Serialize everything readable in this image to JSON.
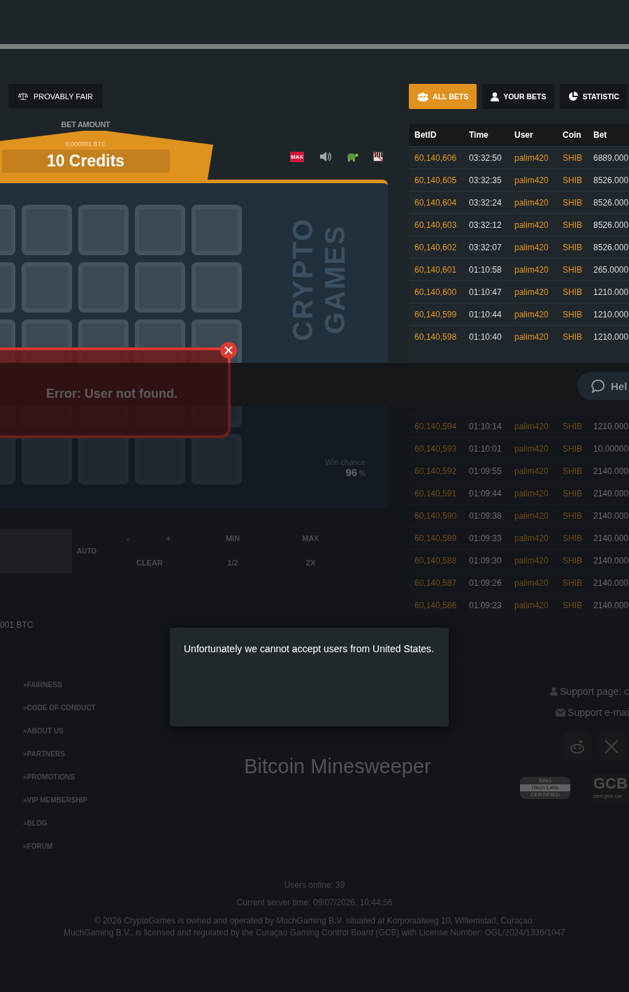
{
  "game_bar": {
    "provably_fair": "PROVABLY FAIR"
  },
  "bet_amount": {
    "label": "BET AMOUNT",
    "btc": "0.000001 BTC",
    "credits": "10 Credits",
    "max_badge": "MAX"
  },
  "board": {
    "logo": "CRYPTO GAMES",
    "win_chance_label": "Win chance",
    "win_chance": "96",
    "win_chance_unit": "%"
  },
  "controls": {
    "auto": "AUTO",
    "buttons": [
      {
        "kind": "minus",
        "label": "-"
      },
      {
        "kind": "plus",
        "label": "+"
      },
      {
        "kind": "wide",
        "label": "MIN"
      },
      {
        "kind": "wide",
        "label": "MAX"
      },
      {
        "kind": "wide",
        "label": "CLEAR"
      },
      {
        "kind": "wide",
        "label": "1/2"
      },
      {
        "kind": "wide",
        "label": "2X"
      }
    ]
  },
  "balance_text": "001 BTC",
  "error_toast": {
    "message": "Error: User not found."
  },
  "bets": {
    "tabs": [
      {
        "label": "ALL BETS",
        "selected": true
      },
      {
        "label": "YOUR BETS",
        "selected": false
      },
      {
        "label": "STATISTIC",
        "selected": false
      }
    ],
    "columns": [
      "BetID",
      "Time",
      "User",
      "Coin",
      "Bet"
    ],
    "rows": [
      [
        "60,140,606",
        "03:32:50",
        "palim420",
        "SHIB",
        "6889.000"
      ],
      [
        "60,140,605",
        "03:32:35",
        "palim420",
        "SHIB",
        "8526.000"
      ],
      [
        "60,140,604",
        "03:32:24",
        "palim420",
        "SHIB",
        "8526.000"
      ],
      [
        "60,140,603",
        "03:32:12",
        "palim420",
        "SHIB",
        "8526.000"
      ],
      [
        "60,140,602",
        "03:32:07",
        "palim420",
        "SHIB",
        "8526.000"
      ],
      [
        "60,140,601",
        "01:10:58",
        "palim420",
        "SHIB",
        "265.0000"
      ],
      [
        "60,140,600",
        "01:10:47",
        "palim420",
        "SHIB",
        "1210.000"
      ],
      [
        "60,140,599",
        "01:10:44",
        "palim420",
        "SHIB",
        "1210.000"
      ],
      [
        "60,140,598",
        "01:10:40",
        "palim420",
        "SHIB",
        "1210.000"
      ]
    ],
    "rows_below": [
      [
        "60,140,594",
        "01:10:14",
        "palim420",
        "SHIB",
        "1210.000"
      ],
      [
        "60,140,593",
        "01:10:01",
        "palim420",
        "SHIB",
        "10.00000"
      ],
      [
        "60,140,592",
        "01:09:55",
        "palim420",
        "SHIB",
        "2140.000"
      ],
      [
        "60,140,591",
        "01:09:44",
        "palim420",
        "SHIB",
        "2140.000"
      ],
      [
        "60,140,590",
        "01:09:38",
        "palim420",
        "SHIB",
        "2140.000"
      ],
      [
        "60,140,589",
        "01:09:33",
        "palim420",
        "SHIB",
        "2140.000"
      ],
      [
        "60,140,588",
        "01:09:30",
        "palim420",
        "SHIB",
        "2140.000"
      ],
      [
        "60,140,587",
        "01:09:26",
        "palim420",
        "SHIB",
        "2140.000"
      ],
      [
        "60,140,586",
        "01:09:23",
        "palim420",
        "SHIB",
        "2140.000"
      ]
    ]
  },
  "help_button": "Hel",
  "footer": {
    "links": [
      "FAIRNESS",
      "CODE OF CONDUCT",
      "ABOUT US",
      "PARTNERS",
      "PROMOTIONS",
      "VIP MEMBERSHIP",
      "BLOG",
      "FORUM"
    ],
    "link_prefix": "»",
    "title": "Bitcoin Minesweeper",
    "support_page": "Support page: c",
    "support_email": "Support e-mai",
    "cert_rng": [
      "RNG",
      "iTech Labs",
      "CERTIFIED"
    ],
    "cert_gcb": [
      "GCB",
      "cert.gcb.cw"
    ],
    "users_online": "Users online: 39",
    "server_time": "Current server time: 09/07/2026, 10:44:56",
    "copyright": [
      "© 2026 CryptoGames is owned and operated by MuchGaming B.V. situated at Korporaalweg 10, Willemstad, Curaçao.",
      "MuchGaming B.V., is licensed and regulated by the Curaçao Gaming Control Board (GCB) with License Number: OGL/2024/1336/1047"
    ]
  },
  "modal": {
    "message": "Unfortunately we cannot accept users from United States."
  }
}
